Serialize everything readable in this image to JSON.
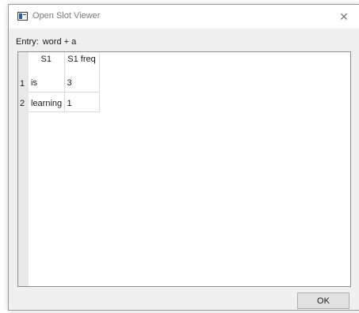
{
  "window": {
    "title": "Open Slot Viewer",
    "close_glyph": "✕"
  },
  "entry": {
    "label": "Entry:",
    "value": "word + a"
  },
  "table": {
    "columns": [
      "S1",
      "S1 freq"
    ],
    "rows": [
      {
        "num": "1",
        "s1": "is",
        "freq": "3"
      },
      {
        "num": "2",
        "s1": "learning",
        "freq": "1"
      }
    ]
  },
  "buttons": {
    "ok_label": "OK"
  },
  "icons": {
    "app": "window-app-icon",
    "close": "close-icon"
  }
}
